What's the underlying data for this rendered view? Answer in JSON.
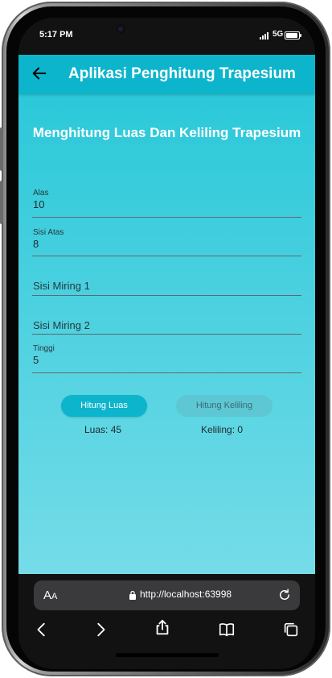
{
  "status_bar": {
    "time": "5:17 PM",
    "network": "5G"
  },
  "app": {
    "title": "Aplikasi Penghitung Trapesium",
    "heading": "Menghitung Luas Dan Keliling Trapesium",
    "fields": {
      "alas": {
        "label": "Alas",
        "value": "10"
      },
      "sisi_atas": {
        "label": "Sisi Atas",
        "value": "8"
      },
      "sisi_miring_1": {
        "placeholder": "Sisi Miring 1"
      },
      "sisi_miring_2": {
        "placeholder": "Sisi Miring 2"
      },
      "tinggi": {
        "label": "Tinggi",
        "value": "5"
      }
    },
    "buttons": {
      "luas": "Hitung Luas",
      "keliling": "Hitung Keliling"
    },
    "results": {
      "luas": "Luas: 45",
      "keliling": "Keliling: 0"
    }
  },
  "browser": {
    "text_size_label_big": "A",
    "text_size_label_small": "A",
    "url": "http://localhost:63998"
  },
  "icons": [
    "back-arrow-icon",
    "lock-icon",
    "reload-icon",
    "nav-back-icon",
    "nav-forward-icon",
    "share-icon",
    "bookmarks-icon",
    "tabs-icon"
  ],
  "colors": {
    "app_bar": "#0cb5cc",
    "gradient_top": "#25c7d8",
    "gradient_bottom": "#75dce8"
  }
}
